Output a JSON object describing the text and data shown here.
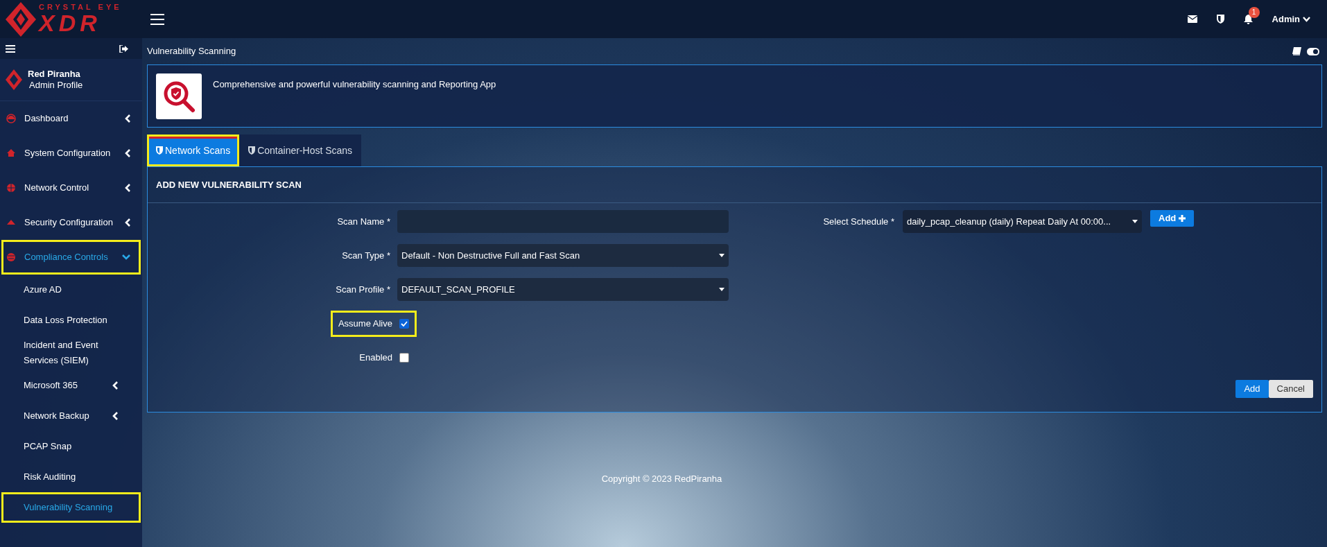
{
  "logo": {
    "tagline": "CRYSTAL EYE",
    "mark": "XDR"
  },
  "header": {
    "notifications": "1",
    "user": "Admin"
  },
  "profile": {
    "name": "Red Piranha",
    "role": "Admin Profile"
  },
  "sidebar": {
    "items": [
      {
        "label": "Dashboard",
        "expanded": false,
        "selected": false,
        "highlighted": false
      },
      {
        "label": "System Configuration",
        "expanded": false,
        "selected": false,
        "highlighted": false
      },
      {
        "label": "Network Control",
        "expanded": false,
        "selected": false,
        "highlighted": false
      },
      {
        "label": "Security Configuration",
        "expanded": false,
        "selected": false,
        "highlighted": false
      },
      {
        "label": "Compliance Controls",
        "expanded": true,
        "selected": true,
        "highlighted": true,
        "children": [
          {
            "label": "Azure AD",
            "selected": false,
            "highlighted": false
          },
          {
            "label": "Data Loss Protection",
            "selected": false,
            "highlighted": false
          },
          {
            "label": "Incident and Event Services (SIEM)",
            "selected": false,
            "highlighted": false
          },
          {
            "label": "Microsoft 365",
            "expanded": false,
            "selected": false,
            "highlighted": false
          },
          {
            "label": "Network Backup",
            "expanded": false,
            "selected": false,
            "highlighted": false
          },
          {
            "label": "PCAP Snap",
            "selected": false,
            "highlighted": false
          },
          {
            "label": "Risk Auditing",
            "selected": false,
            "highlighted": false
          },
          {
            "label": "Vulnerability Scanning",
            "selected": true,
            "highlighted": true
          }
        ]
      }
    ]
  },
  "page": {
    "title": "Vulnerability Scanning",
    "description": "Comprehensive and powerful vulnerability scanning and Reporting App"
  },
  "tabs": [
    {
      "label": "Network Scans",
      "selected": true,
      "highlighted": true
    },
    {
      "label": "Container-Host Scans",
      "selected": false,
      "highlighted": false
    }
  ],
  "form": {
    "title": "ADD NEW VULNERABILITY SCAN",
    "fields": [
      {
        "kind": "text",
        "label": "Scan Name *"
      },
      {
        "kind": "select",
        "label": "Scan Type *",
        "value": "Default - Non Destructive Full and Fast Scan"
      },
      {
        "kind": "select",
        "label": "Scan Profile *",
        "value": "DEFAULT_SCAN_PROFILE"
      },
      {
        "kind": "checkbox",
        "label": "Assume Alive",
        "checked": true,
        "highlighted": true
      },
      {
        "kind": "checkbox",
        "label": "Enabled",
        "checked": false,
        "highlighted": false
      }
    ],
    "schedule": {
      "label": "Select Schedule *",
      "value": "daily_pcap_cleanup (daily) Repeat Daily At 00:00...",
      "add_button": "Add"
    },
    "buttons": [
      {
        "kind": "primary",
        "label": "Add"
      },
      {
        "kind": "secondary",
        "label": "Cancel"
      }
    ]
  },
  "footer": "Copyright © 2023 RedPiranha"
}
